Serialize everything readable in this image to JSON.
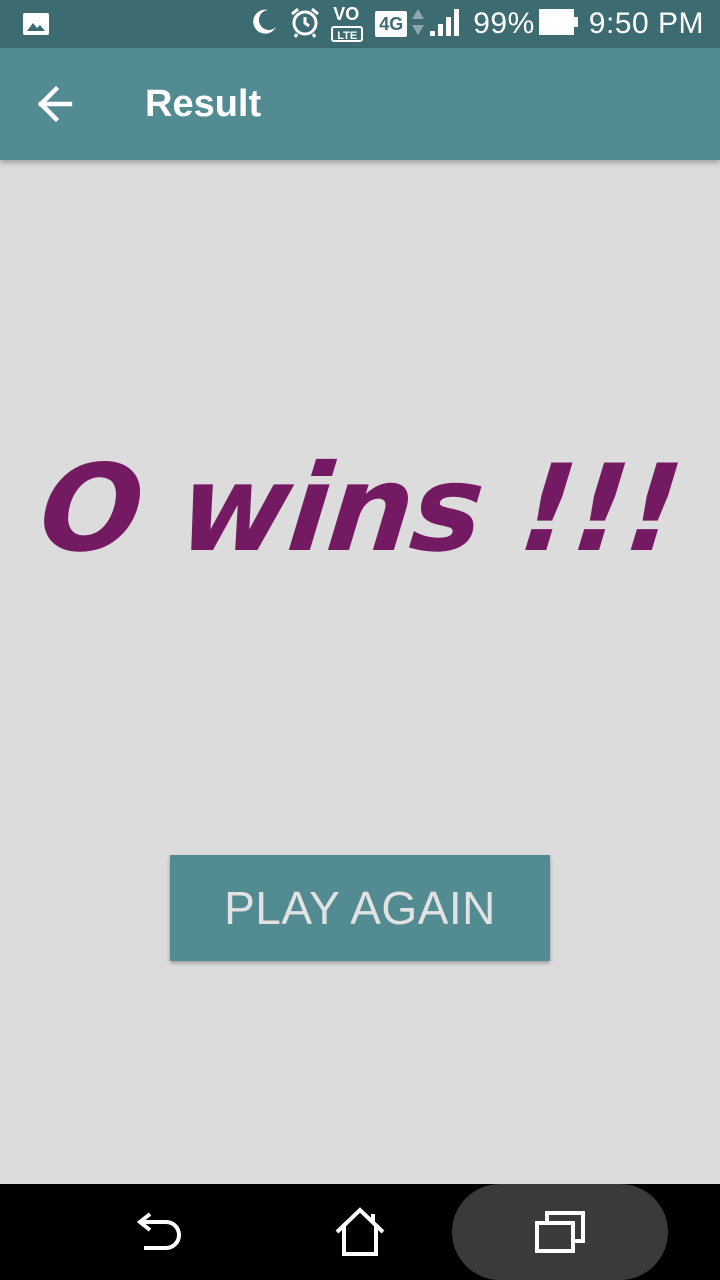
{
  "status_bar": {
    "battery": "99%",
    "time": "9:50 PM",
    "network_badge": "4G",
    "volte_top": "VO",
    "volte_bottom": "LTE",
    "icons": [
      "image-icon",
      "moon-icon",
      "alarm-icon",
      "volte-icon",
      "4g-icon",
      "data-arrows-icon",
      "signal-icon",
      "battery-icon"
    ]
  },
  "app_bar": {
    "title": "Result",
    "back_icon": "arrow-left-icon"
  },
  "main": {
    "result_text": "O wins !!!",
    "play_again_label": "PLAY AGAIN"
  },
  "nav_bar": {
    "icons": [
      "back-nav-icon",
      "home-icon",
      "recent-apps-icon"
    ]
  },
  "colors": {
    "status_bar": "#3c6b72",
    "app_bar": "#528b92",
    "background": "#dcdcdc",
    "result_text": "#741a63",
    "button": "#528b92",
    "button_text": "#e2e2e2"
  }
}
